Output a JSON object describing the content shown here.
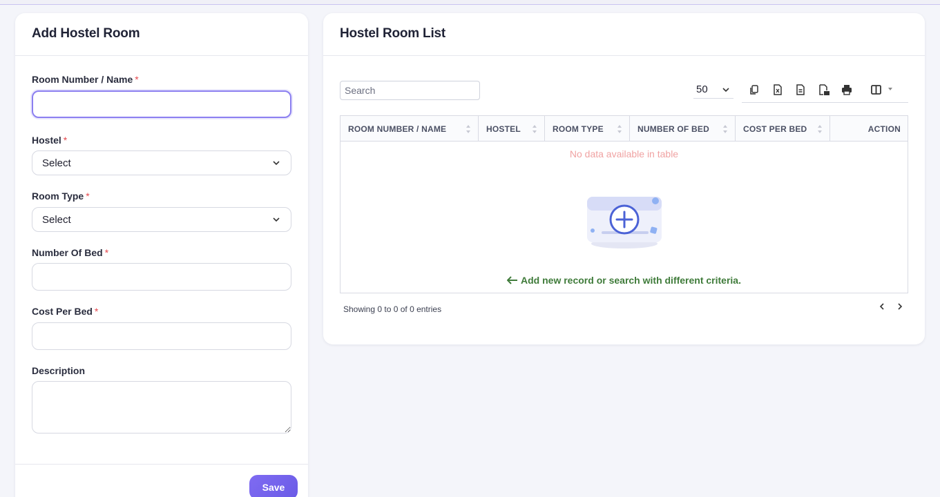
{
  "form": {
    "title": "Add Hostel Room",
    "fields": {
      "room_number": {
        "label": "Room Number / Name",
        "required": "*",
        "value": ""
      },
      "hostel": {
        "label": "Hostel",
        "required": "*",
        "selected": "Select"
      },
      "room_type": {
        "label": "Room Type",
        "required": "*",
        "selected": "Select"
      },
      "number_of_bed": {
        "label": "Number Of Bed",
        "required": "*",
        "value": ""
      },
      "cost_per_bed": {
        "label": "Cost Per Bed",
        "required": "*",
        "value": ""
      },
      "description": {
        "label": "Description",
        "value": ""
      }
    },
    "save_label": "Save"
  },
  "list": {
    "title": "Hostel Room List",
    "search_placeholder": "Search",
    "page_size": "50",
    "toolbar_icons": [
      "copy-icon",
      "excel-icon",
      "csv-icon",
      "pdf-icon",
      "print-icon",
      "columns-icon"
    ],
    "columns": [
      "ROOM NUMBER / NAME",
      "HOSTEL",
      "ROOM TYPE",
      "NUMBER OF BED",
      "COST PER BED",
      "ACTION"
    ],
    "empty_text": "No data available in table",
    "hint_text": "Add new record or search with different criteria.",
    "info_text": "Showing 0 to 0 of 0 entries"
  },
  "colors": {
    "accent": "#7060ea",
    "required": "#e5484d",
    "empty_text": "#f0a2a2",
    "hint": "#3f7b3a"
  }
}
